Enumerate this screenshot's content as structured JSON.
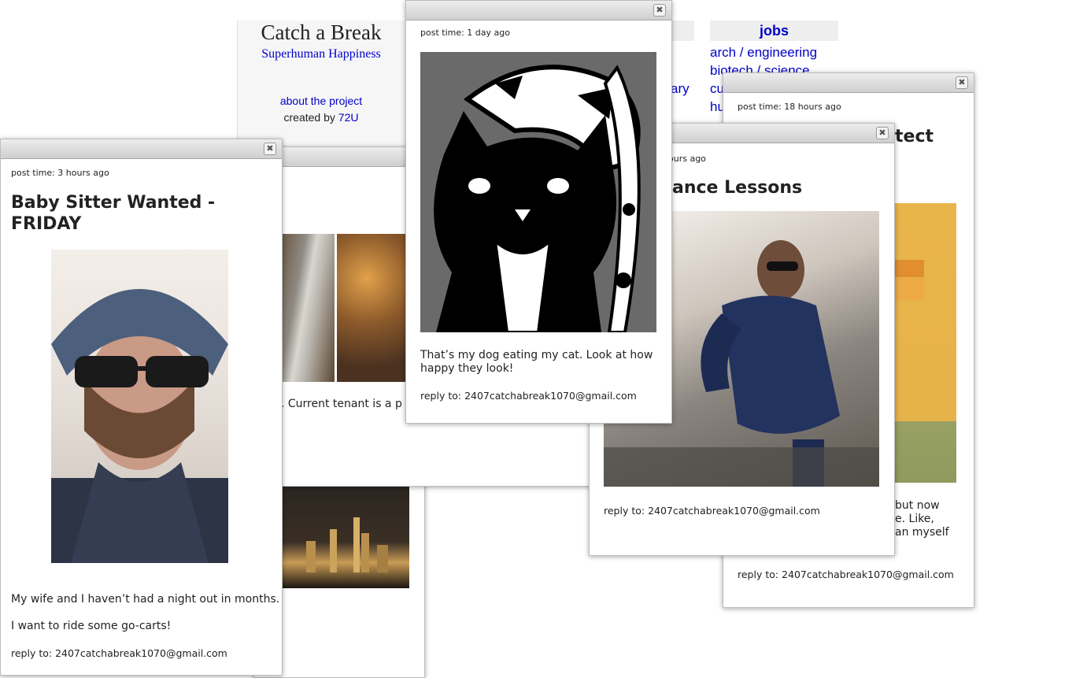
{
  "site": {
    "title": "Catch a Break",
    "tagline": "Superhuman Happiness",
    "about_link": "about the project",
    "created_by_label": "created by",
    "created_by_link": "72U"
  },
  "background_columns": {
    "middle_partial_text": "ary",
    "jobs_heading": "jobs",
    "jobs_links": [
      "arch / engineering",
      "biotech / science",
      "cu",
      "hu"
    ]
  },
  "posts": {
    "baby_sitter": {
      "post_time": "post time: 3 hours ago",
      "title": "Baby Sitter Wanted - FRIDAY",
      "body_line1": "My wife and I haven’t had a night out in months.",
      "body_line2": "I want to ride some go-carts!",
      "reply": "reply to: 2407catchabreak1070@gmail.com"
    },
    "apartment": {
      "body_partial": ". Current tenant is a p"
    },
    "dog_cat": {
      "post_time": "post time: 1 day ago",
      "body": "That’s my dog eating my cat. Look at how happy they look!",
      "reply": "reply to: 2407catchabreak1070@gmail.com"
    },
    "dance": {
      "post_time_partial": "ours ago",
      "title_partial": "ance Lessons",
      "reply": "reply to: 2407catchabreak1070@gmail.com"
    },
    "architect": {
      "post_time": "post time: 18 hours ago",
      "title_partial": "tect",
      "body_line1": "but now",
      "body_line2": "e. Like,",
      "body_line3": "an myself",
      "reply": "reply to: 2407catchabreak1070@gmail.com"
    }
  },
  "icons": {
    "close": "close-icon"
  },
  "colors": {
    "link": "#0000cc",
    "titlebar": "#d8d8d8",
    "text": "#222222"
  }
}
